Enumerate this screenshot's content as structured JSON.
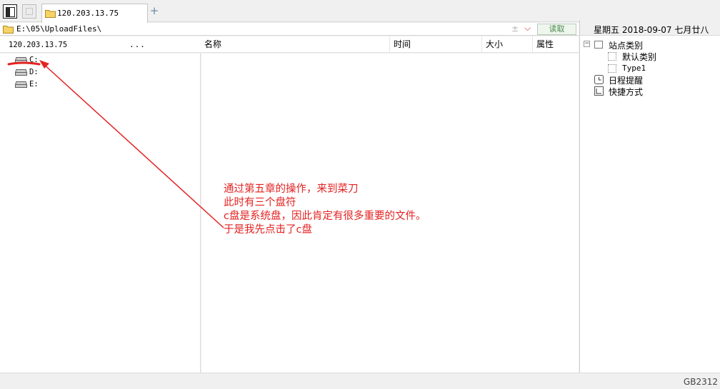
{
  "tabs": [
    {
      "label": "120.203.13.75"
    }
  ],
  "address": {
    "path": "E:\\05\\UploadFiles\\",
    "read_button": "读取"
  },
  "tree": {
    "host": "120.203.13.75",
    "dots": "...",
    "drives": [
      {
        "label": "C:"
      },
      {
        "label": "D:"
      },
      {
        "label": "E:"
      }
    ]
  },
  "columns": {
    "name": "名称",
    "time": "时间",
    "size": "大小",
    "attr": "属性"
  },
  "right_panel": {
    "date": "星期五 2018-09-07 七月廿八",
    "items": [
      {
        "label": "站点类别"
      },
      {
        "label": "默认类别"
      },
      {
        "label": "Type1"
      },
      {
        "label": "日程提醒"
      },
      {
        "label": "快捷方式"
      }
    ]
  },
  "status": {
    "encoding": "GB2312"
  },
  "annotation": {
    "lines": [
      "通过第五章的操作，来到菜刀",
      "此时有三个盘符",
      "c盘是系统盘，因此肯定有很多重要的文件。",
      "于是我先点击了c盘"
    ],
    "color": "#e32222"
  }
}
